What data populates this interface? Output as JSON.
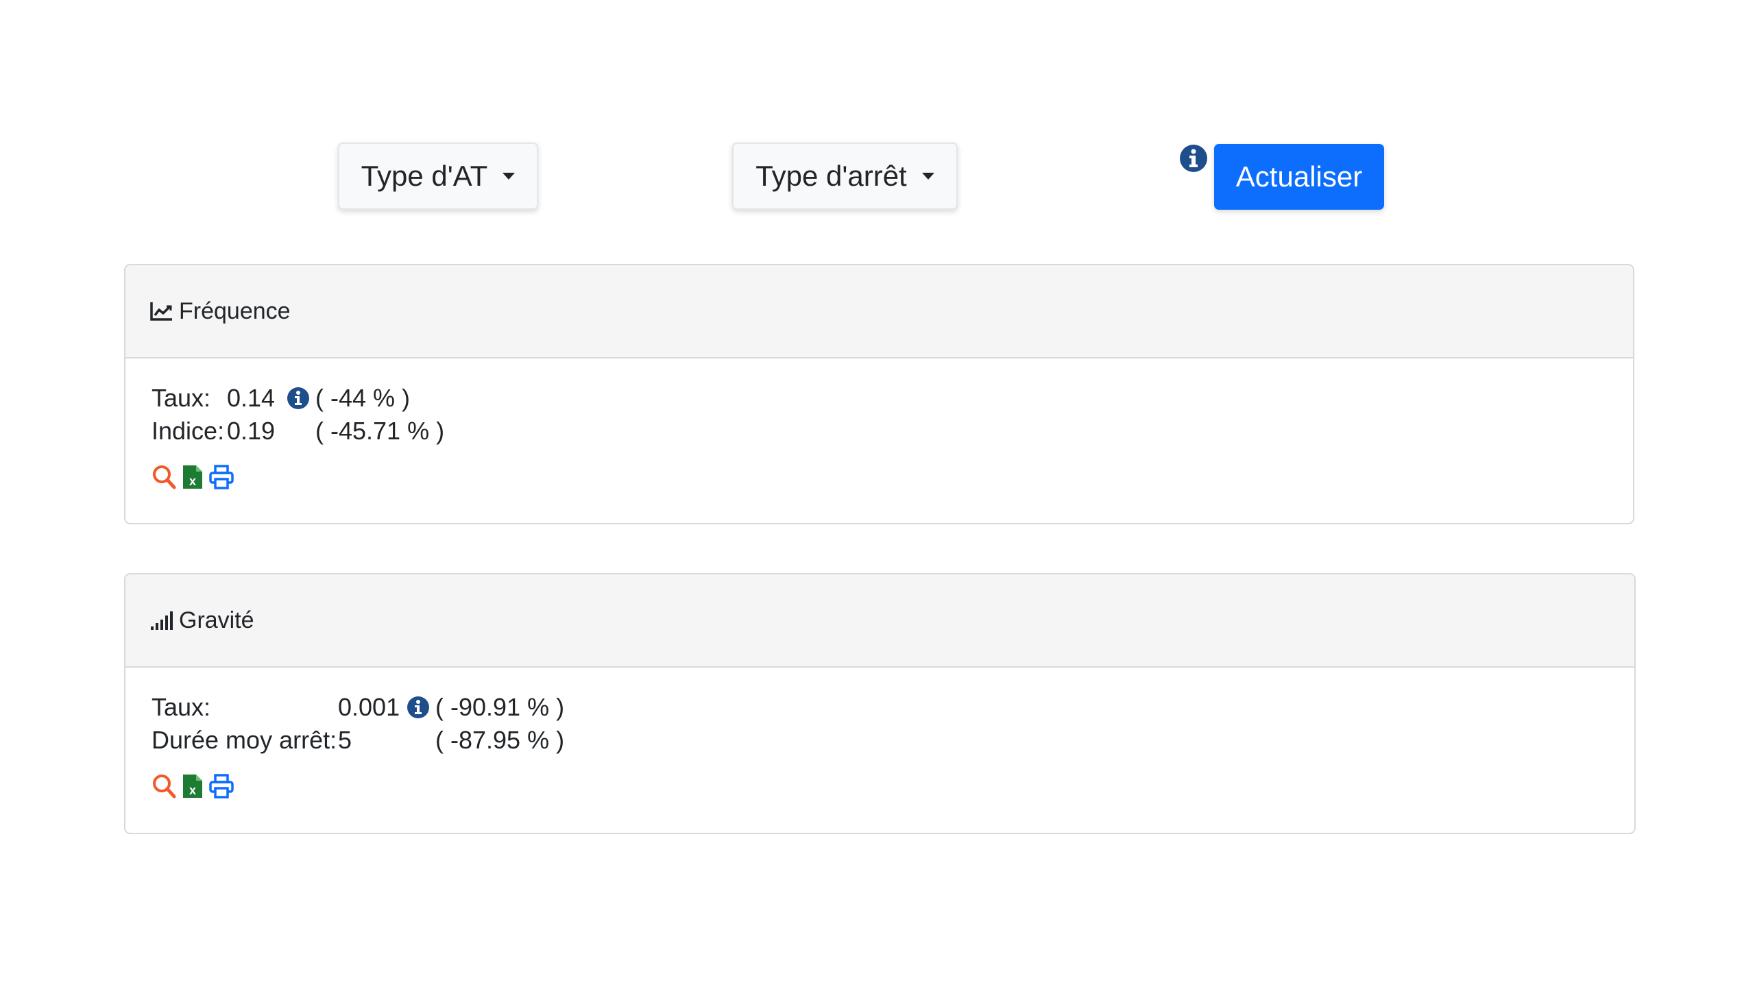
{
  "toolbar": {
    "type_at_label": "Type d'AT",
    "type_arret_label": "Type d'arrêt",
    "refresh_label": "Actualiser"
  },
  "frequence": {
    "title": "Fréquence",
    "rows": [
      {
        "label": "Taux:",
        "value": "0.14",
        "pct": "( -44 % )",
        "has_info": true
      },
      {
        "label": "Indice:",
        "value": "0.19",
        "pct": "( -45.71 % )",
        "has_info": false
      }
    ],
    "actions": [
      "search-icon",
      "excel-icon",
      "print-icon"
    ]
  },
  "gravite": {
    "title": "Gravité",
    "rows": [
      {
        "label": "Taux:",
        "value": "0.001",
        "pct": "( -90.91 % )",
        "has_info": true
      },
      {
        "label": "Durée moy arrêt:",
        "value": "5",
        "pct": "( -87.95 % )",
        "has_info": false
      }
    ],
    "actions": [
      "search-icon",
      "excel-icon",
      "print-icon"
    ]
  },
  "colors": {
    "primary": "#0d6efd",
    "info": "#1f4e8c",
    "search": "#f05a28",
    "excel": "#1e7b34",
    "print": "#0d6efd"
  }
}
